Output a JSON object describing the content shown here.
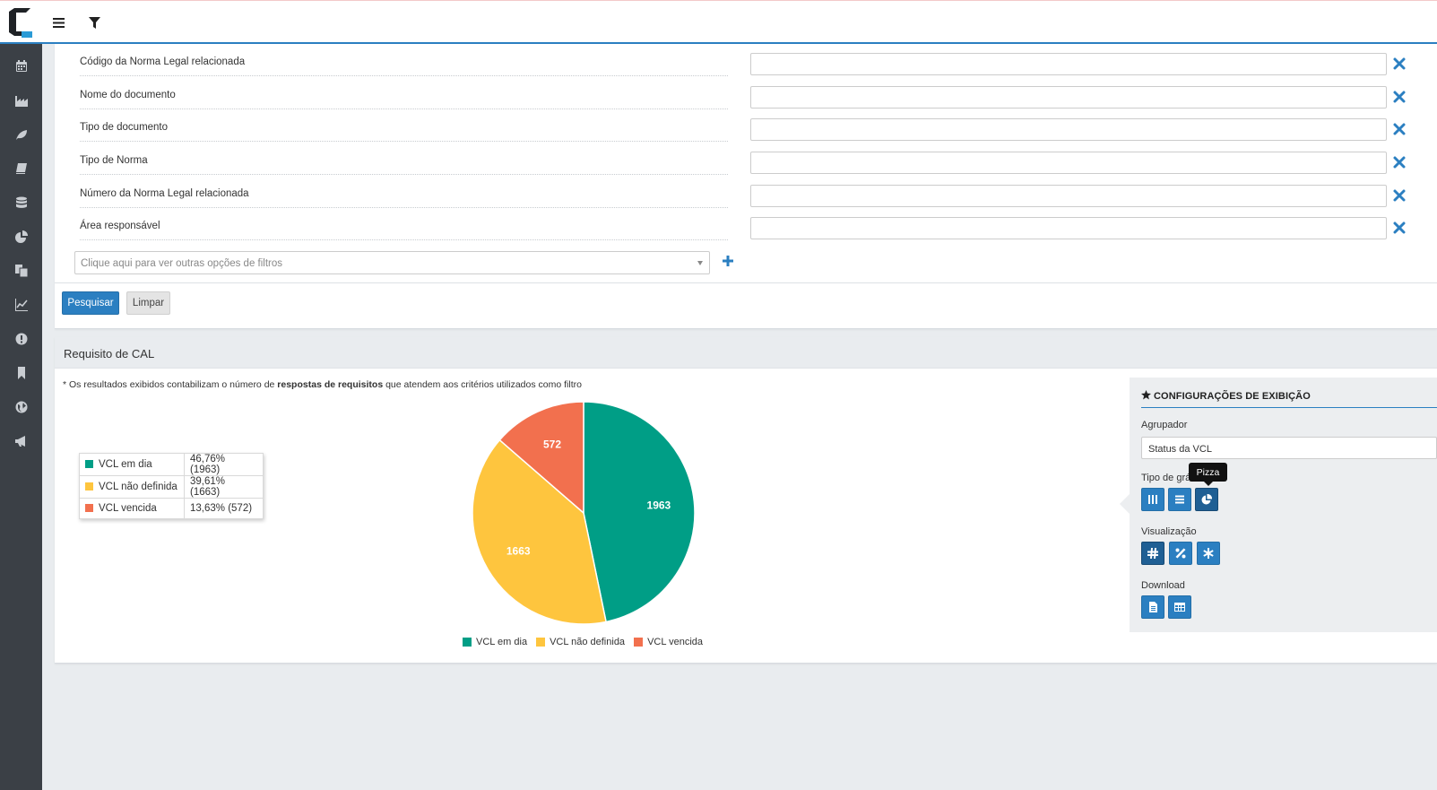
{
  "header": {
    "logo_icon": "app-logo",
    "menu_icon": "hamburger-icon",
    "filter_icon": "filter-funnel-icon"
  },
  "sidebar": {
    "items": [
      {
        "icon": "calendar-icon"
      },
      {
        "icon": "factory-icon"
      },
      {
        "icon": "leaf-icon"
      },
      {
        "icon": "book-icon"
      },
      {
        "icon": "database-icon"
      },
      {
        "icon": "pie-chart-icon"
      },
      {
        "icon": "copy-documents-icon"
      },
      {
        "icon": "line-chart-icon"
      },
      {
        "icon": "exclamation-circle-icon"
      },
      {
        "icon": "bookmark-icon"
      },
      {
        "icon": "globe-icon"
      },
      {
        "icon": "megaphone-icon"
      }
    ]
  },
  "filters": {
    "rows": [
      {
        "label": "Código da Norma Legal relacionada",
        "value": ""
      },
      {
        "label": "Nome do documento",
        "value": ""
      },
      {
        "label": "Tipo de documento",
        "value": ""
      },
      {
        "label": "Tipo de Norma",
        "value": ""
      },
      {
        "label": "Número da Norma Legal relacionada",
        "value": ""
      },
      {
        "label": "Área responsável",
        "value": ""
      }
    ],
    "more_filters_placeholder": "Clique aqui para ver outras opções de filtros",
    "search_label": "Pesquisar",
    "clear_label": "Limpar"
  },
  "results": {
    "title": "Requisito de CAL",
    "note_prefix": "* Os resultados exibidos contabilizam o número de",
    "note_bold": "respostas de requisitos",
    "note_suffix": "que atendem aos critérios utilizados como filtro",
    "legend_table": [
      {
        "name": "VCL em dia",
        "value": "46,76% (1963)"
      },
      {
        "name": "VCL não definida",
        "value": "39,61% (1663)"
      },
      {
        "name": "VCL vencida",
        "value": "13,63% (572)"
      }
    ]
  },
  "chart_data": {
    "type": "pie",
    "categories": [
      "VCL em dia",
      "VCL não definida",
      "VCL vencida"
    ],
    "values": [
      1963,
      1663,
      572
    ],
    "colors": [
      "#009e86",
      "#fec53e",
      "#f2704e"
    ],
    "legend_position": "bottom"
  },
  "config": {
    "title": "CONFIGURAÇÕES DE EXIBIÇÃO",
    "grouper_label": "Agrupador",
    "grouper_value": "Status da VCL",
    "chart_type_label": "Tipo de gráfico",
    "chart_type_tooltip": "Pizza",
    "visualization_label": "Visualização",
    "download_label": "Download"
  }
}
